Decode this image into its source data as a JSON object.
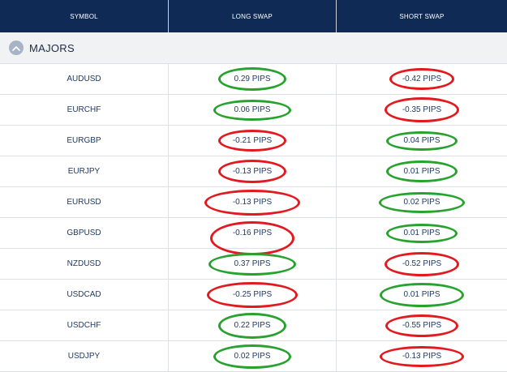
{
  "header": {
    "symbol_label": "SYMBOL",
    "long_label": "LONG SWAP",
    "short_label": "SHORT SWAP",
    "background": "#0f2a55"
  },
  "group": {
    "label": "MAJORS",
    "toggle_icon": "chevron-up-icon"
  },
  "colors": {
    "positive_ring": "#27a22f",
    "negative_ring": "#e2191f",
    "text": "#1f3a66"
  },
  "rows": [
    {
      "symbol": "AUDUSD",
      "long": "0.29 PIPS",
      "long_sign": "pos",
      "short": "-0.42 PIPS",
      "short_sign": "neg"
    },
    {
      "symbol": "EURCHF",
      "long": "0.06 PIPS",
      "long_sign": "pos",
      "short": "-0.35 PIPS",
      "short_sign": "neg"
    },
    {
      "symbol": "EURGBP",
      "long": "-0.21 PIPS",
      "long_sign": "neg",
      "short": "0.04 PIPS",
      "short_sign": "pos"
    },
    {
      "symbol": "EURJPY",
      "long": "-0.13 PIPS",
      "long_sign": "neg",
      "short": "0.01 PIPS",
      "short_sign": "pos"
    },
    {
      "symbol": "EURUSD",
      "long": "-0.13 PIPS",
      "long_sign": "neg",
      "short": "0.02 PIPS",
      "short_sign": "pos"
    },
    {
      "symbol": "GBPUSD",
      "long": "-0.16 PIPS",
      "long_sign": "neg",
      "short": "0.01 PIPS",
      "short_sign": "pos"
    },
    {
      "symbol": "NZDUSD",
      "long": "0.37 PIPS",
      "long_sign": "pos",
      "short": "-0.52 PIPS",
      "short_sign": "neg"
    },
    {
      "symbol": "USDCAD",
      "long": "-0.25 PIPS",
      "long_sign": "neg",
      "short": "0.01 PIPS",
      "short_sign": "pos"
    },
    {
      "symbol": "USDCHF",
      "long": "0.22 PIPS",
      "long_sign": "pos",
      "short": "-0.55 PIPS",
      "short_sign": "neg"
    },
    {
      "symbol": "USDJPY",
      "long": "0.02 PIPS",
      "long_sign": "pos",
      "short": "-0.13 PIPS",
      "short_sign": "neg"
    }
  ]
}
